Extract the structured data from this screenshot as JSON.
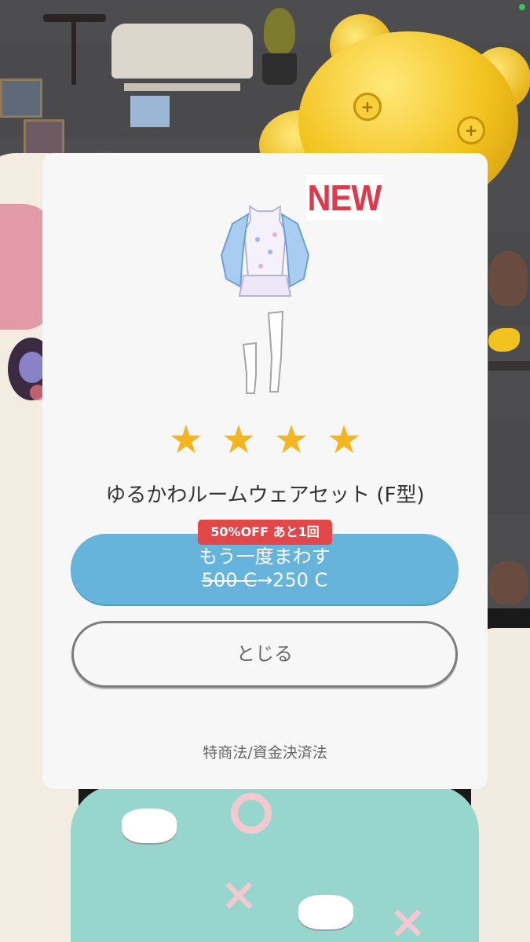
{
  "colors": {
    "dialog_bg": "#f7f7f7",
    "new_badge": "#e0394c",
    "star": "#f5b51f",
    "retry_button": "#66b3dc",
    "discount_badge": "#e2474a",
    "close_border": "#7d7d7d"
  },
  "dialog": {
    "new_badge": "NEW",
    "rarity_stars": 4,
    "star_glyph": "★",
    "item_name": "ゆるかわルームウェアセット (F型)",
    "discount_badge": "50%OFF あと1回",
    "retry_button": {
      "label": "もう一度まわす",
      "price_old": "500 C",
      "arrow": "→",
      "price_new": "250 C"
    },
    "close_button": "とじる",
    "legal_link": "特商法/資金決済法"
  },
  "icons": {
    "item": "room-wear-outfit-icon",
    "rarity": "star-icon"
  }
}
